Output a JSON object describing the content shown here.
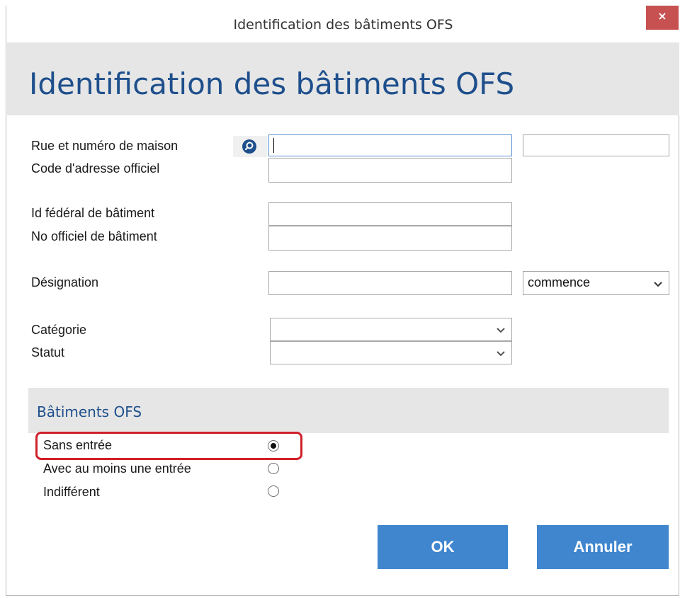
{
  "window": {
    "title": "Identification des bâtiments OFS",
    "close_glyph": "×"
  },
  "header": {
    "title": "Identification des bâtiments OFS"
  },
  "form": {
    "street_label": "Rue et numéro de maison",
    "street_value": "",
    "street_number_value": "",
    "address_code_label": "Code d'adresse officiel",
    "address_code_value": "",
    "federal_id_label": "Id fédéral de bâtiment",
    "federal_id_value": "",
    "official_no_label": "No officiel de bâtiment",
    "official_no_value": "",
    "designation_label": "Désignation",
    "designation_value": "",
    "designation_mode": "commence",
    "category_label": "Catégorie",
    "category_value": "",
    "status_label": "Statut",
    "status_value": ""
  },
  "section": {
    "title": "Bâtiments OFS",
    "options": [
      {
        "label": "Sans entrée",
        "checked": true
      },
      {
        "label": "Avec au moins une entrée",
        "checked": false
      },
      {
        "label": "Indifférent",
        "checked": false
      }
    ]
  },
  "buttons": {
    "ok": "OK",
    "cancel": "Annuler"
  },
  "icons": {
    "search": "search-icon",
    "close": "close-icon",
    "chevron": "chevron-down-icon"
  },
  "colors": {
    "accent": "#1e4f8c",
    "button": "#3f86cf",
    "close": "#c75050",
    "highlight": "#d0202a"
  }
}
